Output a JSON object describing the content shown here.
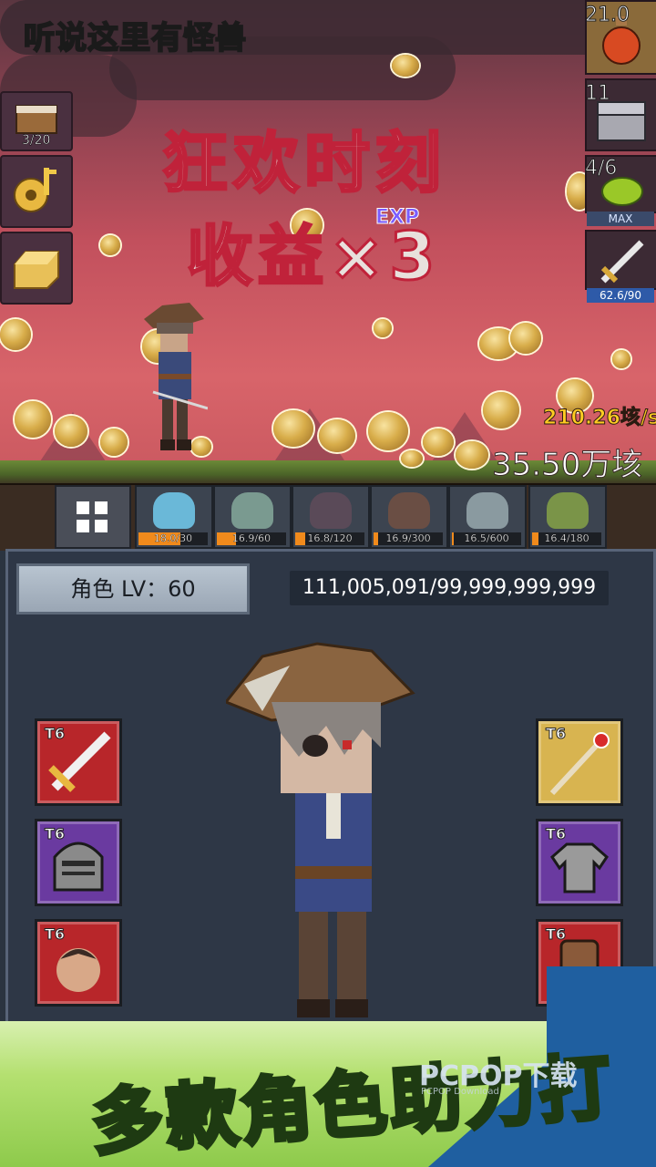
{
  "header": {
    "title": "听说这里有怪兽"
  },
  "event": {
    "line1": "狂欢时刻",
    "line2": "收益×3",
    "exp_label": "EXP"
  },
  "income": {
    "rate": "210.26垓/s",
    "total": "35.50万垓"
  },
  "left_items": [
    {
      "name": "crate-icon",
      "count": "3/20"
    },
    {
      "name": "golden-key-icon",
      "count": ""
    },
    {
      "name": "gold-bar-icon",
      "count": ""
    }
  ],
  "right_items": [
    {
      "name": "potion-icon",
      "count": "21.0"
    },
    {
      "name": "treasure-chest-icon",
      "count": "11"
    },
    {
      "name": "slime-icon",
      "count": "4/6",
      "badge": "MAX"
    },
    {
      "name": "sword-icon",
      "count": "",
      "badge": "62.6/90"
    }
  ],
  "monsters": [
    {
      "name": "blue-slime",
      "progress": "18.0/30",
      "fill": 0.6,
      "color": "#6ab8d8"
    },
    {
      "name": "zombie",
      "progress": "16.9/60",
      "fill": 0.28,
      "color": "#7a9a90"
    },
    {
      "name": "bat-demon",
      "progress": "16.8/120",
      "fill": 0.14,
      "color": "#5a4a58"
    },
    {
      "name": "tentacle-beast",
      "progress": "16.9/300",
      "fill": 0.06,
      "color": "#6a4e44"
    },
    {
      "name": "hooded-ghost",
      "progress": "16.5/600",
      "fill": 0.03,
      "color": "#8a9aa0"
    },
    {
      "name": "goblin",
      "progress": "16.4/180",
      "fill": 0.09,
      "color": "#7a9448"
    }
  ],
  "character": {
    "level_label": "角色 LV：60",
    "exp": "111,005,091/99,999,999,999"
  },
  "equipment": {
    "left": [
      {
        "slot": "weapon",
        "tier": "T6",
        "rarity": "red"
      },
      {
        "slot": "helmet",
        "tier": "T6",
        "rarity": "purple"
      },
      {
        "slot": "companion",
        "tier": "T6",
        "rarity": "red"
      }
    ],
    "right": [
      {
        "slot": "staff",
        "tier": "T6",
        "rarity": "gold"
      },
      {
        "slot": "armor",
        "tier": "T6",
        "rarity": "purple"
      },
      {
        "slot": "backpack",
        "tier": "T6",
        "rarity": "red"
      }
    ]
  },
  "promo": {
    "text": "多款角色助力打"
  },
  "watermark": {
    "text": "PCPOP下载",
    "sub": "PCPOP Download"
  }
}
